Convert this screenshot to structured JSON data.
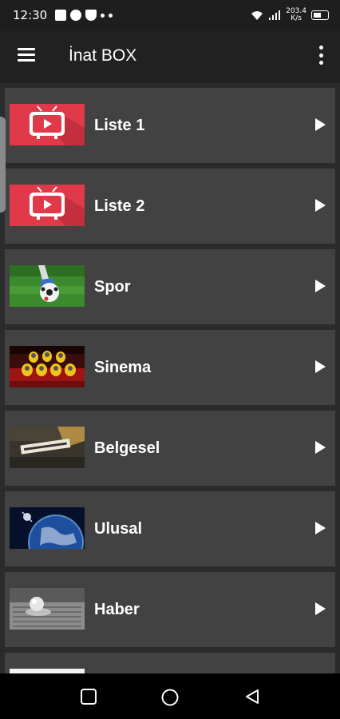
{
  "status_bar": {
    "time": "12:30",
    "speed_value": "203.4",
    "speed_unit": "K/s"
  },
  "app_bar": {
    "title": "İnat BOX",
    "menu_icon": "hamburger-menu-icon",
    "overflow_icon": "more-vert-icon"
  },
  "items": [
    {
      "label": "Liste 1",
      "thumb": "tv-play-thumbnail"
    },
    {
      "label": "Liste 2",
      "thumb": "tv-play-thumbnail"
    },
    {
      "label": "Spor",
      "thumb": "football-thumbnail"
    },
    {
      "label": "Sinema",
      "thumb": "minions-cinema-thumbnail"
    },
    {
      "label": "Belgesel",
      "thumb": "documentary-thumbnail"
    },
    {
      "label": "Ulusal",
      "thumb": "earth-thumbnail"
    },
    {
      "label": "Haber",
      "thumb": "newspaper-thumbnail"
    },
    {
      "label": "",
      "thumb": "partial-thumbnail"
    }
  ],
  "colors": {
    "background": "#2b2b2b",
    "card": "#424242",
    "app_bar": "#212121",
    "tv_red": "#e03a4a"
  }
}
